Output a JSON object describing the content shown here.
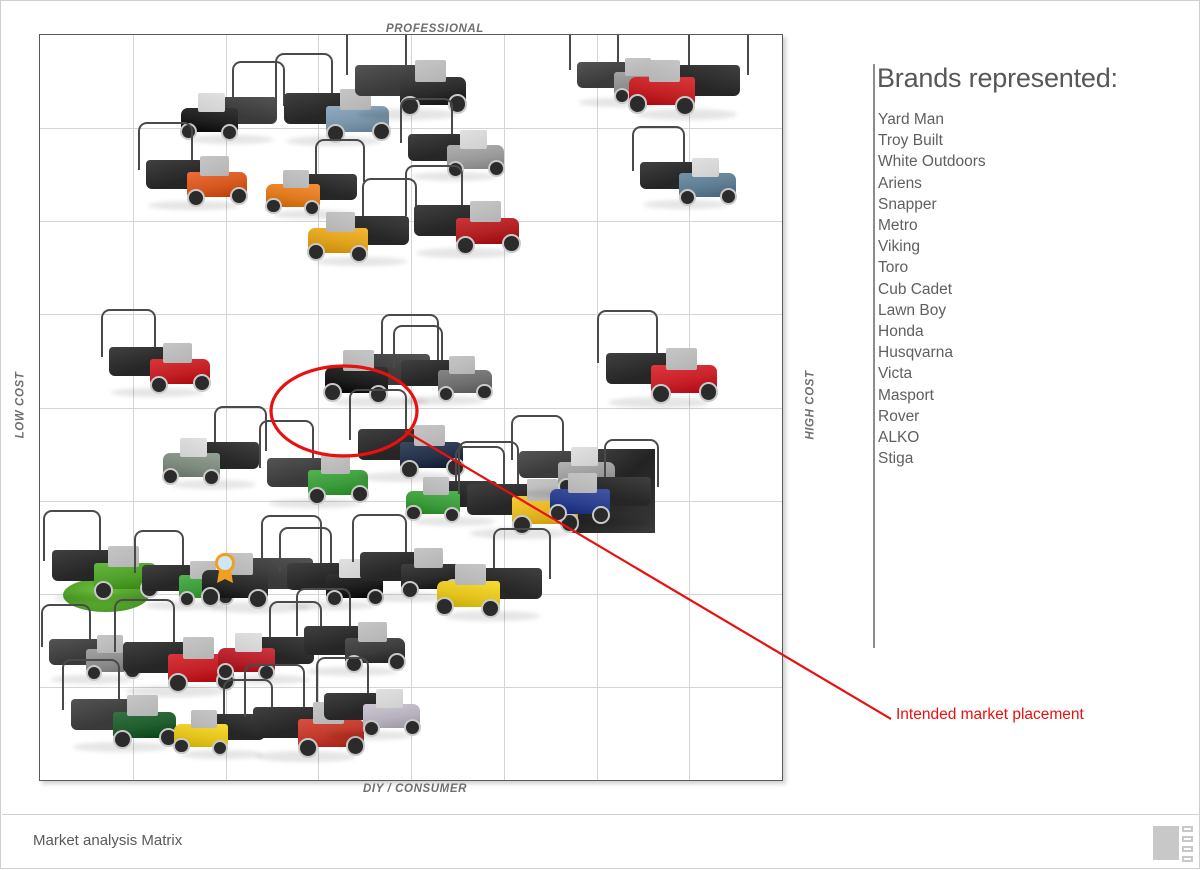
{
  "document": {
    "footer_title": "Market analysis Matrix",
    "logo_name": "studio-logo"
  },
  "matrix": {
    "axis": {
      "top": "PROFESSIONAL",
      "bottom": "DIY / CONSUMER",
      "left": "LOW COST",
      "right": "HIGH COST"
    },
    "grid": {
      "columns": 8,
      "rows": 8
    }
  },
  "brands": {
    "title": "Brands represented:",
    "items": [
      "Yard Man",
      "Troy Built",
      "White Outdoors",
      "Ariens",
      "Snapper",
      "Metro",
      "Viking",
      "Toro",
      "Cub Cadet",
      "Lawn Boy",
      "Honda",
      "Husqvarna",
      "Victa",
      "Masport",
      "Rover",
      "ALKO",
      "Stiga"
    ]
  },
  "callout": {
    "label": "Intended market placement",
    "color": "#e8110f"
  },
  "chart_data": {
    "type": "scatter",
    "title": "Market analysis Matrix",
    "xlabel": "DIY / CONSUMER  →  PROFESSIONAL",
    "ylabel": "LOW COST  →  HIGH COST",
    "xlim": [
      0,
      8
    ],
    "ylim": [
      0,
      8
    ],
    "grid": true,
    "legend": "none",
    "annotations": [
      {
        "text": "Intended market placement",
        "x": 3.6,
        "y": 4.2,
        "color": "#e8110f",
        "marker": "ellipse"
      }
    ],
    "points": [
      {
        "x": 2.0,
        "y": 7.0,
        "color": "#1f1f1f",
        "label": "mower"
      },
      {
        "x": 1.6,
        "y": 6.3,
        "color": "#d4581f",
        "label": "mower"
      },
      {
        "x": 3.1,
        "y": 7.0,
        "color": "#7b96ab",
        "label": "mower"
      },
      {
        "x": 2.9,
        "y": 6.2,
        "color": "#e07a1f",
        "label": "mower"
      },
      {
        "x": 3.9,
        "y": 7.3,
        "color": "#2b2b2b",
        "label": "mower"
      },
      {
        "x": 4.4,
        "y": 6.6,
        "color": "#9a9a9a",
        "label": "mower"
      },
      {
        "x": 3.4,
        "y": 5.7,
        "color": "#e0a21c",
        "label": "mower"
      },
      {
        "x": 4.5,
        "y": 5.8,
        "color": "#b32024",
        "label": "mower"
      },
      {
        "x": 6.2,
        "y": 7.4,
        "color": "#8d8d8d",
        "label": "mower"
      },
      {
        "x": 6.9,
        "y": 7.3,
        "color": "#c42127",
        "label": "mower"
      },
      {
        "x": 6.9,
        "y": 6.3,
        "color": "#5e7d93",
        "label": "mower"
      },
      {
        "x": 1.2,
        "y": 4.3,
        "color": "#c32026",
        "label": "mower"
      },
      {
        "x": 3.6,
        "y": 4.2,
        "color": "#1d1d1d",
        "label": "target-product"
      },
      {
        "x": 4.3,
        "y": 4.2,
        "color": "#6f6f6f",
        "label": "mower"
      },
      {
        "x": 6.6,
        "y": 4.2,
        "color": "#c8212a",
        "label": "mower"
      },
      {
        "x": 1.8,
        "y": 3.3,
        "color": "#7d8a7d",
        "label": "mower"
      },
      {
        "x": 2.9,
        "y": 3.1,
        "color": "#3c9b3a",
        "label": "mower"
      },
      {
        "x": 3.9,
        "y": 3.4,
        "color": "#26324a",
        "label": "mower"
      },
      {
        "x": 4.4,
        "y": 2.9,
        "color": "#3c9b3a",
        "label": "mower"
      },
      {
        "x": 5.1,
        "y": 2.8,
        "color": "#e3b520",
        "label": "mower"
      },
      {
        "x": 5.6,
        "y": 3.2,
        "color": "#9c9c9c",
        "label": "mower"
      },
      {
        "x": 6.0,
        "y": 2.9,
        "color": "#2c3f8f",
        "label": "mower"
      },
      {
        "x": 0.6,
        "y": 2.1,
        "color": "#4fa02a",
        "label": "mower"
      },
      {
        "x": 1.5,
        "y": 2.0,
        "color": "#3c9b3a",
        "label": "mower"
      },
      {
        "x": 2.3,
        "y": 2.0,
        "color": "#2a2a2a",
        "label": "mower"
      },
      {
        "x": 3.1,
        "y": 2.0,
        "color": "#1d1d1d",
        "label": "mower"
      },
      {
        "x": 3.9,
        "y": 2.1,
        "color": "#2a2a2a",
        "label": "mower"
      },
      {
        "x": 4.8,
        "y": 1.9,
        "color": "#e3c51d",
        "label": "mower"
      },
      {
        "x": 0.5,
        "y": 1.2,
        "color": "#8c8c8c",
        "label": "mower"
      },
      {
        "x": 1.4,
        "y": 1.1,
        "color": "#c22026",
        "label": "mower"
      },
      {
        "x": 2.4,
        "y": 1.2,
        "color": "#b5202a",
        "label": "mower"
      },
      {
        "x": 3.3,
        "y": 1.3,
        "color": "#3b3b3b",
        "label": "mower"
      },
      {
        "x": 0.8,
        "y": 0.5,
        "color": "#1f5c2e",
        "label": "mower"
      },
      {
        "x": 1.9,
        "y": 0.4,
        "color": "#e3c51d",
        "label": "mower"
      },
      {
        "x": 2.8,
        "y": 0.4,
        "color": "#c0392b",
        "label": "mower"
      },
      {
        "x": 3.5,
        "y": 0.6,
        "color": "#b7b2bd",
        "label": "mower"
      }
    ]
  }
}
